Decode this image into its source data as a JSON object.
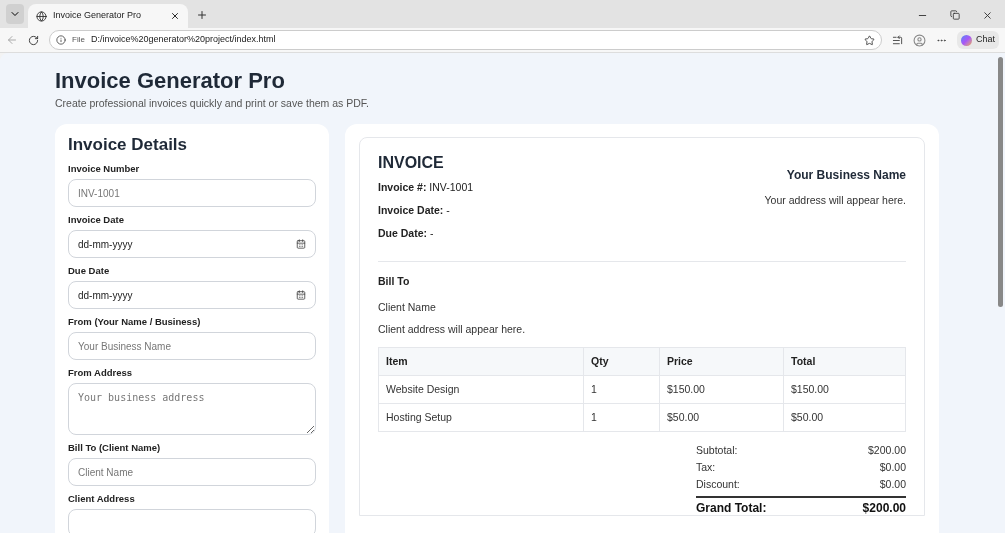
{
  "browser": {
    "tab_title": "Invoice Generator Pro",
    "scheme": "File",
    "url": "D:/invoice%20generator%20project/index.html",
    "chat": "Chat"
  },
  "page": {
    "title": "Invoice Generator Pro",
    "subtitle": "Create professional invoices quickly and print or save them as PDF."
  },
  "form": {
    "title": "Invoice Details",
    "fields": [
      {
        "kind": "text",
        "label": "Invoice Number",
        "placeholder": "INV-1001"
      },
      {
        "kind": "date",
        "label": "Invoice Date",
        "placeholder": "dd-mm-yyyy"
      },
      {
        "kind": "date",
        "label": "Due Date",
        "placeholder": "dd-mm-yyyy"
      },
      {
        "kind": "text",
        "label": "From (Your Name / Business)",
        "placeholder": "Your Business Name"
      },
      {
        "kind": "textarea",
        "label": "From Address",
        "placeholder": "Your business address"
      },
      {
        "kind": "text",
        "label": "Bill To (Client Name)",
        "placeholder": "Client Name"
      },
      {
        "kind": "cut",
        "label": "Client Address"
      }
    ]
  },
  "invoice": {
    "heading": "INVOICE",
    "meta": [
      {
        "label": "Invoice #:",
        "value": "INV-1001"
      },
      {
        "label": "Invoice Date:",
        "value": "-"
      },
      {
        "label": "Due Date:",
        "value": "-"
      }
    ],
    "business_name": "Your Business Name",
    "business_address": "Your address will appear here.",
    "bill_to": {
      "heading": "Bill To",
      "name": "Client Name",
      "address": "Client address will appear here."
    },
    "table": {
      "columns": [
        "Item",
        "Qty",
        "Price",
        "Total"
      ],
      "rows": [
        [
          "Website Design",
          "1",
          "$150.00",
          "$150.00"
        ],
        [
          "Hosting Setup",
          "1",
          "$50.00",
          "$50.00"
        ]
      ]
    },
    "totals": [
      {
        "label": "Subtotal:",
        "value": "$200.00"
      },
      {
        "label": "Tax:",
        "value": "$0.00"
      },
      {
        "label": "Discount:",
        "value": "$0.00"
      }
    ],
    "grand_total": {
      "label": "Grand Total:",
      "value": "$200.00"
    }
  }
}
